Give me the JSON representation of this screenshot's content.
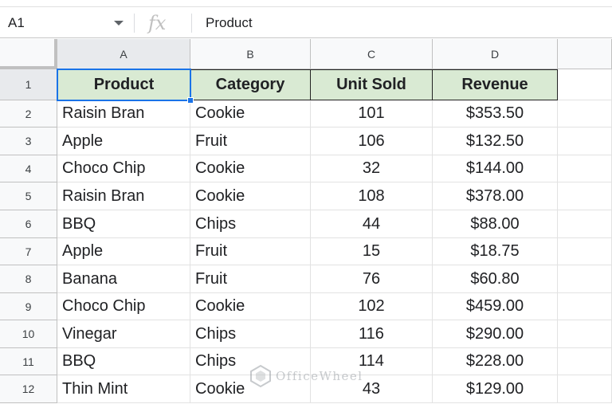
{
  "formula_bar": {
    "name_box": "A1",
    "fx_symbol": "fx",
    "content": "Product"
  },
  "columns": [
    "A",
    "B",
    "C",
    "D",
    ""
  ],
  "rows": [
    "1",
    "2",
    "3",
    "4",
    "5",
    "6",
    "7",
    "8",
    "9",
    "10",
    "11",
    "12"
  ],
  "table": {
    "headers": [
      "Product",
      "Category",
      "Unit Sold",
      "Revenue"
    ],
    "rows": [
      [
        "Raisin Bran",
        "Cookie",
        "101",
        "$353.50"
      ],
      [
        "Apple",
        "Fruit",
        "106",
        "$132.50"
      ],
      [
        "Choco Chip",
        "Cookie",
        "32",
        "$144.00"
      ],
      [
        "Raisin Bran",
        "Cookie",
        "108",
        "$378.00"
      ],
      [
        "BBQ",
        "Chips",
        "44",
        "$88.00"
      ],
      [
        "Apple",
        "Fruit",
        "15",
        "$18.75"
      ],
      [
        "Banana",
        "Fruit",
        "76",
        "$60.80"
      ],
      [
        "Choco Chip",
        "Cookie",
        "102",
        "$459.00"
      ],
      [
        "Vinegar",
        "Chips",
        "116",
        "$290.00"
      ],
      [
        "BBQ",
        "Chips",
        "114",
        "$228.00"
      ],
      [
        "Thin Mint",
        "Cookie",
        "43",
        "$129.00"
      ]
    ]
  },
  "active_cell": "A1",
  "colors": {
    "header_fill": "#d9ead3",
    "selection": "#1a73e8",
    "header_bg": "#f8f9fa"
  },
  "watermark": {
    "text": "OfficeWheel"
  }
}
